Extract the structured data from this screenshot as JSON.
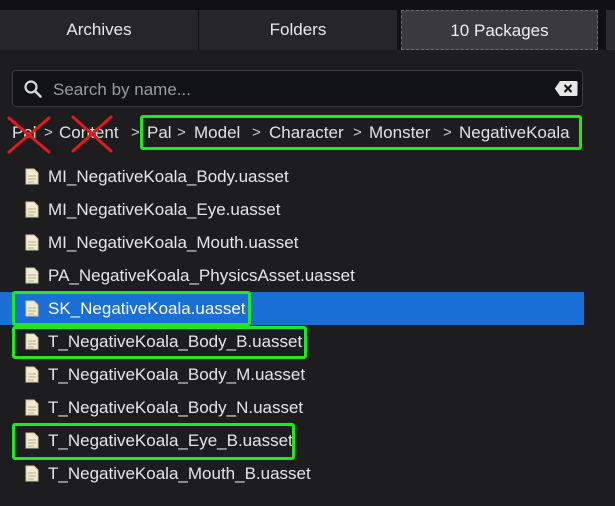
{
  "tabs": [
    {
      "label": "Archives"
    },
    {
      "label": "Folders"
    },
    {
      "label": "10 Packages"
    }
  ],
  "search": {
    "placeholder": "Search by name..."
  },
  "breadcrumb": {
    "items": [
      "Pal",
      "Content",
      "Pal",
      "Model",
      "Character",
      "Monster",
      "NegativeKoala"
    ],
    "separator": ">"
  },
  "files": [
    {
      "name": "MI_NegativeKoala_Body.uasset"
    },
    {
      "name": "MI_NegativeKoala_Eye.uasset"
    },
    {
      "name": "MI_NegativeKoala_Mouth.uasset"
    },
    {
      "name": "PA_NegativeKoala_PhysicsAsset.uasset"
    },
    {
      "name": "SK_NegativeKoala.uasset",
      "selected": true
    },
    {
      "name": "T_NegativeKoala_Body_B.uasset"
    },
    {
      "name": "T_NegativeKoala_Body_M.uasset"
    },
    {
      "name": "T_NegativeKoala_Body_N.uasset"
    },
    {
      "name": "T_NegativeKoala_Eye_B.uasset"
    },
    {
      "name": "T_NegativeKoala_Mouth_B.uasset"
    }
  ],
  "colors": {
    "selection": "#1a6fd6",
    "highlight": "#1ee81e",
    "cross": "#e01a1a"
  }
}
